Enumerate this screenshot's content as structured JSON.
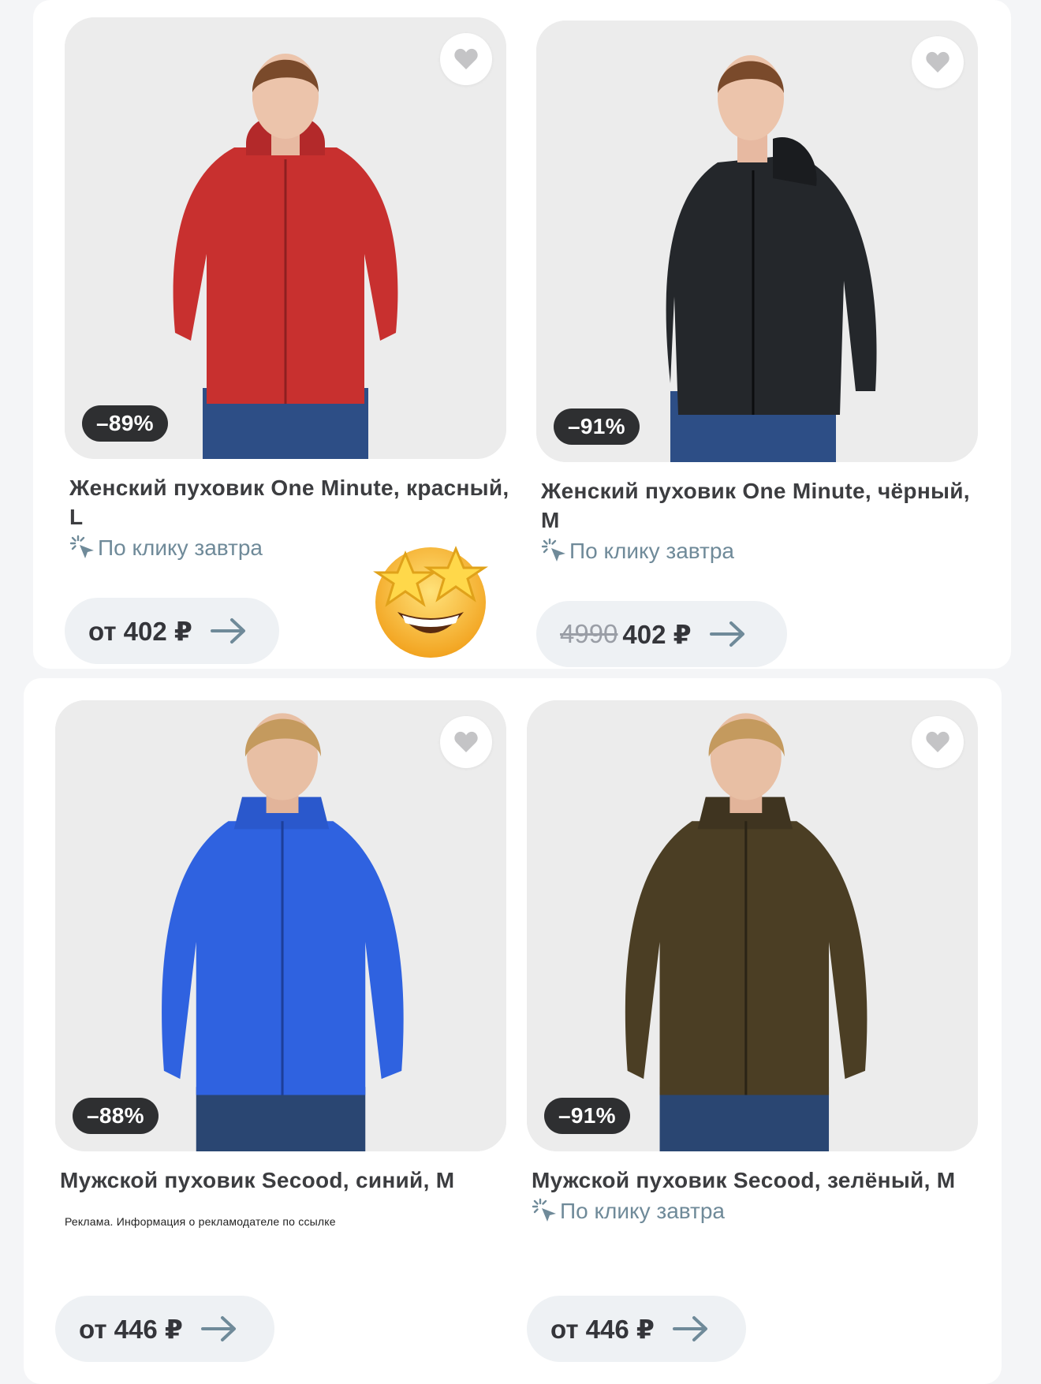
{
  "products": [
    {
      "title": "Женский пуховик One Minute, красный, L",
      "discount": "–89%",
      "delivery": "По клику завтра",
      "price_old": "",
      "price_text": "от 402 ₽",
      "ad_note": "",
      "jacket_color": "#c8302f"
    },
    {
      "title": "Женский пуховик One Minute, чёрный, M",
      "discount": "–91%",
      "delivery": "По клику завтра",
      "price_old": "4990",
      "price_text": "402 ₽",
      "ad_note": "",
      "jacket_color": "#24272b"
    },
    {
      "title": "Мужской пуховик Secood, синий, M",
      "discount": "–88%",
      "delivery": "",
      "price_old": "",
      "price_text": "от 446 ₽",
      "ad_note": "Реклама. Информация о рекламодателе по ссылке",
      "jacket_color": "#2f62e0"
    },
    {
      "title": "Мужской пуховик Secood, зелёный, M",
      "discount": "–91%",
      "delivery": "По клику завтра",
      "price_old": "",
      "price_text": "от 446 ₽",
      "ad_note": "",
      "jacket_color": "#4b3e24"
    }
  ],
  "icons": {
    "favorite": "heart-icon",
    "delivery": "sparkle-cursor-icon",
    "price_arrow": "arrow-right-icon",
    "decoration": "star-struck-emoji"
  },
  "colors": {
    "badge_bg": "#2e2f31",
    "delivery_text": "#6f8a99",
    "button_bg": "#eef1f4"
  }
}
